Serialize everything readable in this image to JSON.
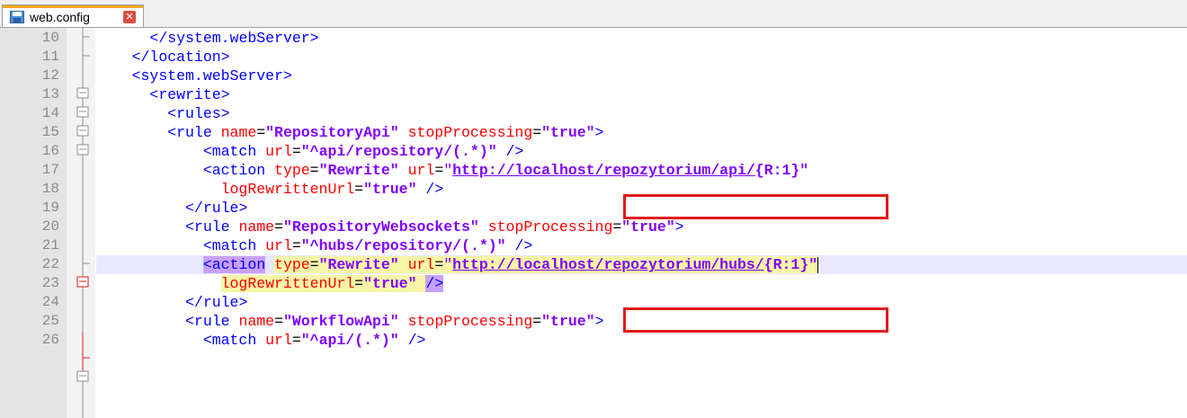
{
  "tab": {
    "label": "web.config",
    "icon": "save-file-icon",
    "close_icon": "close-icon"
  },
  "lines": [
    {
      "no": "10",
      "tokens": [
        [
          "      ",
          ""
        ],
        [
          "</system.webServer>",
          "tag"
        ]
      ]
    },
    {
      "no": "11",
      "tokens": [
        [
          "    ",
          ""
        ],
        [
          "</location>",
          "tag"
        ]
      ]
    },
    {
      "no": "12",
      "tokens": [
        [
          "    ",
          ""
        ],
        [
          "<system.webServer>",
          "tag"
        ]
      ]
    },
    {
      "no": "13",
      "tokens": [
        [
          "      ",
          ""
        ],
        [
          "<rewrite>",
          "tag"
        ]
      ]
    },
    {
      "no": "14",
      "tokens": [
        [
          "        ",
          ""
        ],
        [
          "<rules>",
          "tag"
        ]
      ]
    },
    {
      "no": "15",
      "tokens": [
        [
          "        ",
          ""
        ],
        [
          "<rule",
          "tag"
        ],
        [
          " ",
          ""
        ],
        [
          "name",
          "attr"
        ],
        [
          "=",
          "eq"
        ],
        [
          "\"RepositoryApi\"",
          "val"
        ],
        [
          " ",
          ""
        ],
        [
          "stopProcessing",
          "attr"
        ],
        [
          "=",
          "eq"
        ],
        [
          "\"true\"",
          "val"
        ],
        [
          ">",
          "tag"
        ]
      ]
    },
    {
      "no": "16",
      "tokens": [
        [
          "            ",
          ""
        ],
        [
          "<match",
          "tag"
        ],
        [
          " ",
          ""
        ],
        [
          "url",
          "attr"
        ],
        [
          "=",
          "eq"
        ],
        [
          "\"^api/repository/(.*)\"",
          "val"
        ],
        [
          " ",
          ""
        ],
        [
          "/>",
          "tag"
        ]
      ]
    },
    {
      "no": "17",
      "tokens": [
        [
          "            ",
          ""
        ],
        [
          "<action",
          "tag"
        ],
        [
          " ",
          ""
        ],
        [
          "type",
          "attr"
        ],
        [
          "=",
          "eq"
        ],
        [
          "\"Rewrite\"",
          "val"
        ],
        [
          " ",
          ""
        ],
        [
          "url",
          "attr"
        ],
        [
          "=",
          "eq"
        ],
        [
          "\"",
          "q"
        ],
        [
          "http://localhost/repozytorium/api/",
          "url"
        ],
        [
          "{R:1}\"",
          "val"
        ]
      ]
    },
    {
      "no": "18",
      "tokens": [
        [
          "              ",
          ""
        ],
        [
          "logRewrittenUrl",
          "attr"
        ],
        [
          "=",
          "eq"
        ],
        [
          "\"true\"",
          "val"
        ],
        [
          " ",
          ""
        ],
        [
          "/>",
          "tag"
        ]
      ]
    },
    {
      "no": "19",
      "tokens": [
        [
          "          ",
          ""
        ],
        [
          "</rule>",
          "tag"
        ]
      ]
    },
    {
      "no": "20",
      "tokens": [
        [
          "          ",
          ""
        ],
        [
          "<rule",
          "tag"
        ],
        [
          " ",
          ""
        ],
        [
          "name",
          "attr"
        ],
        [
          "=",
          "eq"
        ],
        [
          "\"RepositoryWebsockets\"",
          "val"
        ],
        [
          " ",
          ""
        ],
        [
          "stopProcessing",
          "attr"
        ],
        [
          "=",
          "eq"
        ],
        [
          "\"true\"",
          "val"
        ],
        [
          ">",
          "tag"
        ]
      ]
    },
    {
      "no": "21",
      "tokens": [
        [
          "            ",
          ""
        ],
        [
          "<match",
          "tag"
        ],
        [
          " ",
          ""
        ],
        [
          "url",
          "attr"
        ],
        [
          "=",
          "eq"
        ],
        [
          "\"^hubs/repository/(.*)\"",
          "val"
        ],
        [
          " ",
          ""
        ],
        [
          "/>",
          "tag"
        ]
      ]
    },
    {
      "no": "22",
      "current": true,
      "tokens": [
        [
          "            ",
          ""
        ],
        [
          "<action",
          "tag hl-match"
        ],
        [
          " ",
          ""
        ],
        [
          "type",
          "attr hl-y"
        ],
        [
          "=",
          "eq hl-y"
        ],
        [
          "\"Rewrite\"",
          "val hl-y"
        ],
        [
          " ",
          "hl-y"
        ],
        [
          "url",
          "attr hl-y"
        ],
        [
          "=",
          "eq hl-y"
        ],
        [
          "\"",
          "q hl-y"
        ],
        [
          "http://localhost/repozytorium/hubs/",
          "url hl-y"
        ],
        [
          "{R:1}\"",
          "val hl-y"
        ]
      ],
      "caret": true
    },
    {
      "no": "23",
      "tokens": [
        [
          "              ",
          ""
        ],
        [
          "logRewrittenUrl",
          "attr hl-y"
        ],
        [
          "=",
          "eq hl-y"
        ],
        [
          "\"true\"",
          "val hl-y"
        ],
        [
          " ",
          "hl-y"
        ],
        [
          "/>",
          "tag hl-match"
        ]
      ]
    },
    {
      "no": "24",
      "tokens": [
        [
          "          ",
          ""
        ],
        [
          "</rule>",
          "tag"
        ]
      ]
    },
    {
      "no": "25",
      "tokens": [
        [
          "          ",
          ""
        ],
        [
          "<rule",
          "tag"
        ],
        [
          " ",
          ""
        ],
        [
          "name",
          "attr"
        ],
        [
          "=",
          "eq"
        ],
        [
          "\"WorkflowApi\"",
          "val"
        ],
        [
          " ",
          ""
        ],
        [
          "stopProcessing",
          "attr"
        ],
        [
          "=",
          "eq"
        ],
        [
          "\"true\"",
          "val"
        ],
        [
          ">",
          "tag"
        ]
      ]
    },
    {
      "no": "26",
      "tokens": [
        [
          "            ",
          ""
        ],
        [
          "<match",
          "tag"
        ],
        [
          " ",
          ""
        ],
        [
          "url",
          "attr"
        ],
        [
          "=",
          "eq"
        ],
        [
          "\"^api/(.*)\"",
          "val"
        ],
        [
          " ",
          ""
        ],
        [
          "/>",
          "tag"
        ]
      ]
    }
  ],
  "colors": {
    "highlight_box": "#e01a1a",
    "current_line": "#e8e8ff",
    "fold_active": "#e01a1a"
  }
}
